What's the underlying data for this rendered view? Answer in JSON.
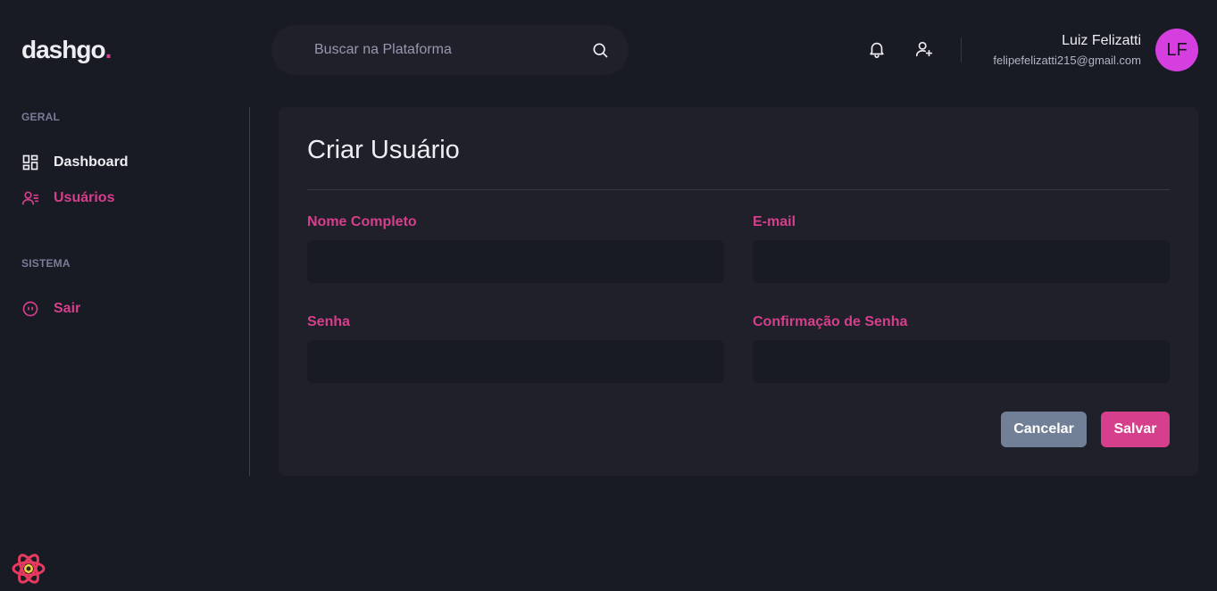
{
  "header": {
    "logo_text": "dashgo",
    "logo_dot": ".",
    "search_placeholder": "Buscar na Plataforma",
    "user_name": "Luiz Felizatti",
    "user_email": "felipefelizatti215@gmail.com",
    "avatar_initials": "LF"
  },
  "sidebar": {
    "sections": [
      {
        "title": "GERAL",
        "items": [
          {
            "label": "Dashboard",
            "icon": "dashboard-icon"
          },
          {
            "label": "Usuários",
            "icon": "users-icon"
          }
        ]
      },
      {
        "title": "SISTEMA",
        "items": [
          {
            "label": "Sair",
            "icon": "logout-icon"
          }
        ]
      }
    ]
  },
  "form": {
    "title": "Criar Usuário",
    "fields": {
      "name_label": "Nome Completo",
      "email_label": "E-mail",
      "password_label": "Senha",
      "password_confirm_label": "Confirmação de Senha"
    },
    "cancel_label": "Cancelar",
    "save_label": "Salvar"
  },
  "colors": {
    "background": "#181b23",
    "card": "#1f2029",
    "accent": "#d53f8c",
    "cancel_button": "#718096",
    "avatar": "#d53fe0"
  }
}
